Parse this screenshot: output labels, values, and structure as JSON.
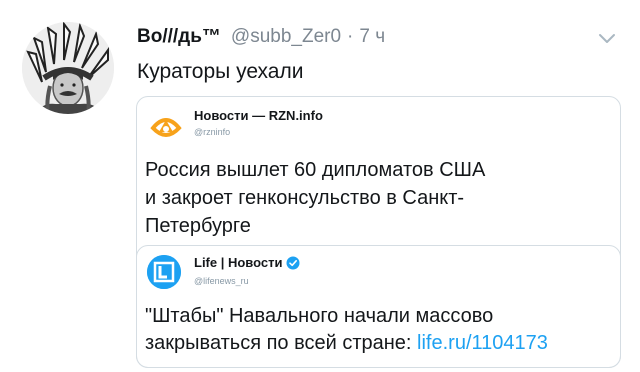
{
  "tweet": {
    "display_name": "Во///дь™",
    "handle": "@subb_Zer0",
    "separator": "·",
    "time": "7 ч",
    "text": "Кураторы уехали",
    "avatar_icon": "portrait-native-headdress"
  },
  "quoted_tweet": {
    "name": "Новости — RZN.info",
    "handle": "@rzninfo",
    "avatar_icon": "rzn-logo",
    "text_lines": [
      "Россия вышлет 60 дипломатов США",
      "и закроет генконсульство в Санкт-",
      "Петербурге"
    ]
  },
  "nested_quoted_tweet": {
    "name": "Life | Новости",
    "handle": "@lifenews_ru",
    "avatar_icon": "life-logo",
    "verified_icon": "verified-badge",
    "text_line1": "\"Штабы\" Навального начали массово",
    "text_line2": "закрываться по всей стране: ",
    "link": "life.ru/1104173"
  },
  "colors": {
    "link": "#1da1f2",
    "secondary_text": "#7d8791",
    "border": "#d5dde3",
    "rzn_orange": "#f7a21b"
  }
}
